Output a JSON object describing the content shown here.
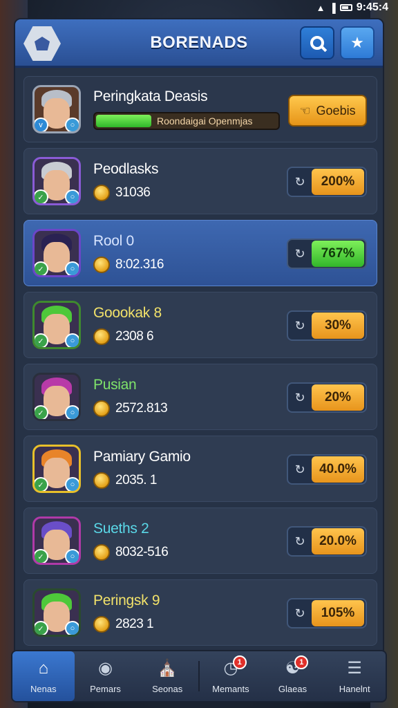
{
  "status_bar": {
    "time": "9:45:4"
  },
  "header": {
    "title": "BORENADS"
  },
  "top_entry": {
    "name": "Peringkata Deasis",
    "progress_text": "Roondaigai Openmjas",
    "progress_fraction": 0.3,
    "button_label": "Goebis"
  },
  "rows": [
    {
      "name": "Peodlasks",
      "score": "31036",
      "percent": "200%",
      "name_color": "#ffffff",
      "pct_style": "orange",
      "hair": "#c9ccd2",
      "frame": "#8a5bd6"
    },
    {
      "name": "Rool 0",
      "score": "8:02.316",
      "percent": "767%",
      "name_color": "#d7e4ff",
      "pct_style": "green",
      "hair": "#2a2252",
      "frame": "#6b46c8",
      "highlight": true
    },
    {
      "name": "Goookak 8",
      "score": "2308 6",
      "percent": "30%",
      "name_color": "#f2e26a",
      "pct_style": "orange",
      "hair": "#4ec83a",
      "frame": "#3f8a2e"
    },
    {
      "name": "Pusian",
      "score": "2572.813",
      "percent": "20%",
      "name_color": "#7fe36a",
      "pct_style": "orange",
      "hair": "#b83aa8",
      "frame": "#2a2f3c"
    },
    {
      "name": "Pamiary Gamio",
      "score": "2035. 1",
      "percent": "40.0%",
      "name_color": "#ffffff",
      "pct_style": "orange",
      "hair": "#e8842a",
      "frame": "#e8c02a"
    },
    {
      "name": "Sueths 2",
      "score": "8032-516",
      "percent": "20.0%",
      "name_color": "#5ad8e8",
      "pct_style": "orange",
      "hair": "#6a4ec8",
      "frame": "#b03aa8"
    },
    {
      "name": "Peringsk 9",
      "score": "2823 1",
      "percent": "105%",
      "name_color": "#f2e26a",
      "pct_style": "orange",
      "hair": "#4ec83a",
      "frame": "#2a4a2e"
    }
  ],
  "nav": [
    {
      "label": "Nenas",
      "icon": "home-icon",
      "active": true
    },
    {
      "label": "Pemars",
      "icon": "shield-icon"
    },
    {
      "label": "Seonas",
      "icon": "house-icon"
    },
    {
      "label": "Memants",
      "icon": "clock-icon",
      "badge": "1"
    },
    {
      "label": "Glaeas",
      "icon": "people-icon",
      "badge": "1"
    },
    {
      "label": "Hanelnt",
      "icon": "menu-icon"
    }
  ]
}
